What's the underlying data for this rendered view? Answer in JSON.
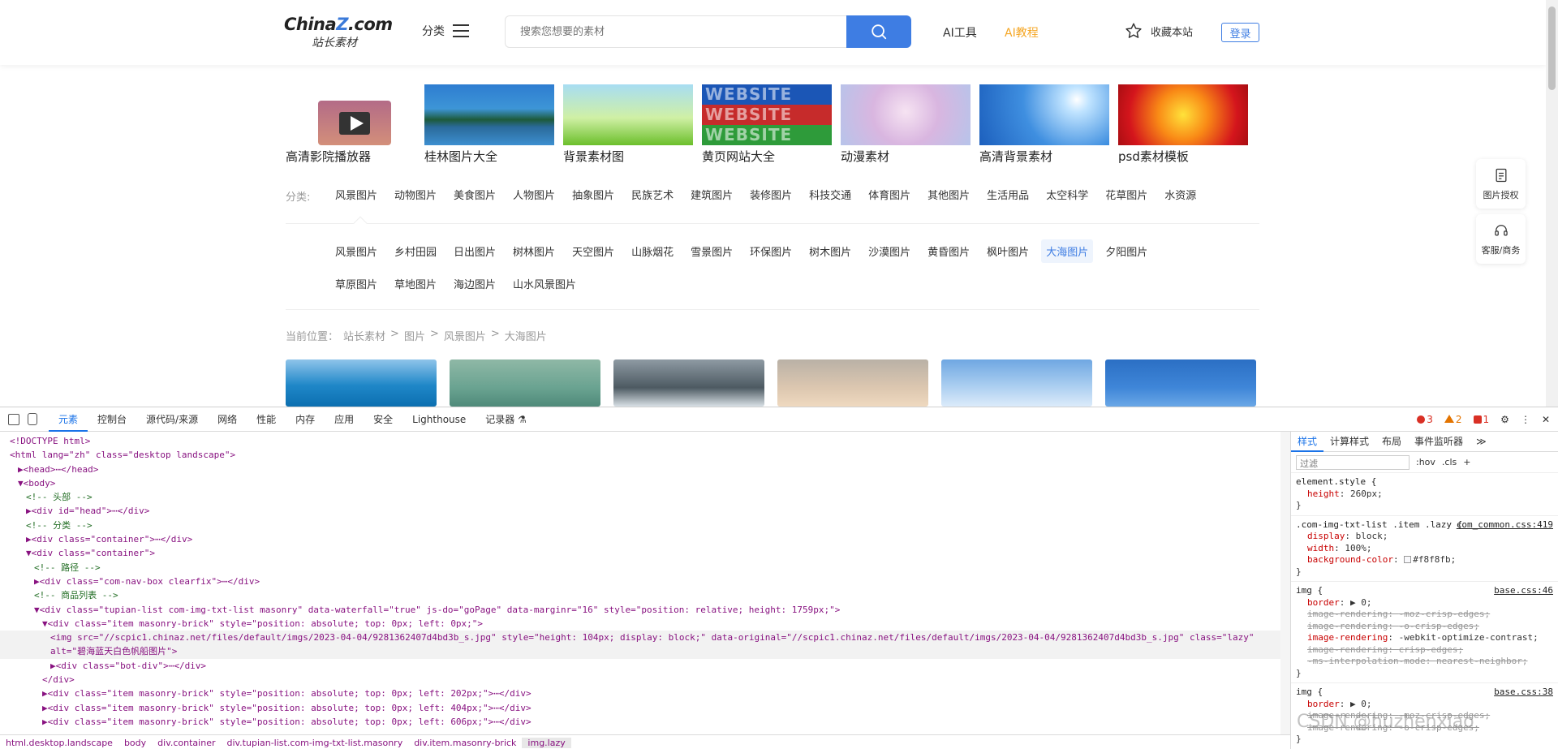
{
  "header": {
    "logo_main": "Chinaz.com",
    "logo_z": "Z",
    "logo_pre": "China",
    "logo_post": ".com",
    "logo_sub": "站长素材",
    "category_label": "分类",
    "search_placeholder": "搜索您想要的素材",
    "nav_ai_tools": "AI工具",
    "nav_ai_course": "AI教程",
    "favorite_label": "收藏本站",
    "login_label": "登录",
    "accent_color": "#3e7de3"
  },
  "featured": [
    {
      "caption": "高清影院播放器"
    },
    {
      "caption": "桂林图片大全"
    },
    {
      "caption": "背景素材图"
    },
    {
      "caption": "黄页网站大全",
      "overlay": [
        "WEBSITE",
        "WEBSITE",
        "WEBSITE"
      ]
    },
    {
      "caption": "动漫素材"
    },
    {
      "caption": "高清背景素材"
    },
    {
      "caption": "psd素材模板"
    }
  ],
  "categories": {
    "label": "分类:",
    "items": [
      "风景图片",
      "动物图片",
      "美食图片",
      "人物图片",
      "抽象图片",
      "民族艺术",
      "建筑图片",
      "装修图片",
      "科技交通",
      "体育图片",
      "其他图片",
      "生活用品",
      "太空科学",
      "花草图片",
      "水资源"
    ],
    "active": "风景图片"
  },
  "sub_categories": {
    "row1": [
      "风景图片",
      "乡村田园",
      "日出图片",
      "树林图片",
      "天空图片",
      "山脉烟花",
      "雪景图片",
      "环保图片",
      "树木图片",
      "沙漠图片",
      "黄昏图片",
      "枫叶图片",
      "大海图片",
      "夕阳图片"
    ],
    "row2": [
      "草原图片",
      "草地图片",
      "海边图片",
      "山水风景图片"
    ],
    "active": "大海图片"
  },
  "breadcrumb": {
    "prefix": "当前位置：",
    "items": [
      "站长素材",
      "图片",
      "风景图片",
      "大海图片"
    ],
    "separator": ">"
  },
  "side_buttons": [
    {
      "label": "图片授权"
    },
    {
      "label": "客服/商务"
    }
  ],
  "devtools": {
    "tabs": [
      "元素",
      "控制台",
      "源代码/来源",
      "网络",
      "性能",
      "内存",
      "应用",
      "安全",
      "Lighthouse",
      "记录器 ⚗"
    ],
    "active_tab": "元素",
    "error_count": "3",
    "warning_count": "2",
    "issue_count": "1",
    "style_tabs": [
      "样式",
      "计算样式",
      "布局",
      "事件监听器",
      "≫"
    ],
    "filter_placeholder": "过滤",
    "filter_hov": ":hov",
    "filter_cls": ".cls",
    "dom_lines": [
      "<!DOCTYPE html>",
      "<html lang=\"zh\" class=\"desktop landscape\">",
      "▶<head>⋯</head>",
      "▼<body>",
      "<!-- 头部 -->",
      "▶<div id=\"head\">⋯</div>",
      "<!-- 分类 -->",
      "▶<div class=\"container\">⋯</div>",
      "▼<div class=\"container\">",
      "<!-- 路径 -->",
      "▶<div class=\"com-nav-box clearfix\">⋯</div>",
      "<!-- 商品列表 -->",
      "▼<div class=\"tupian-list com-img-txt-list masonry\" data-waterfall=\"true\" js-do=\"goPage\" data-marginr=\"16\" style=\"position: relative; height: 1759px;\">",
      "▼<div class=\"item masonry-brick\" style=\"position: absolute; top: 0px; left: 0px;\">",
      "<img src=\"//scpic1.chinaz.net/files/default/imgs/2023-04-04/9281362407d4bd3b_s.jpg\" style=\"height: 104px; display: block;\" data-original=\"//scpic1.chinaz.net/files/default/imgs/2023-04-04/9281362407d4bd3b_s.jpg\" class=\"lazy\"",
      "alt=\"碧海蓝天白色帆船图片\">",
      "▶<div class=\"bot-div\">⋯</div>",
      "</div>",
      "▶<div class=\"item masonry-brick\" style=\"position: absolute; top: 0px; left: 202px;\">⋯</div>",
      "▶<div class=\"item masonry-brick\" style=\"position: absolute; top: 0px; left: 404px;\">⋯</div>",
      "▶<div class=\"item masonry-brick\" style=\"position: absolute; top: 0px; left: 606px;\">⋯</div>"
    ],
    "status_path": [
      "html.desktop.landscape",
      "body",
      "div.container",
      "div.tupian-list.com-img-txt-list.masonry",
      "div.item.masonry-brick",
      "img.lazy"
    ],
    "styles": [
      {
        "selector": "element.style {",
        "source": "",
        "props": [
          [
            "height",
            "260px;"
          ]
        ]
      },
      {
        "selector": ".com-img-txt-list .item .lazy {",
        "source": "com_common.css:419",
        "props": [
          [
            "display",
            "block;"
          ],
          [
            "width",
            "100%;"
          ],
          [
            "background-color",
            "#f8f8fb;"
          ]
        ]
      },
      {
        "selector": "img {",
        "source": "base.css:46",
        "props": [
          [
            "border",
            "▶ 0;"
          ],
          [
            "image-rendering",
            "-moz-crisp-edges;"
          ],
          [
            "image-rendering",
            "-o-crisp-edges;"
          ],
          [
            "image-rendering",
            "-webkit-optimize-contrast;"
          ],
          [
            "image-rendering",
            "crisp-edges;"
          ],
          [
            "-ms-interpolation-mode",
            "nearest-neighbor;"
          ]
        ]
      },
      {
        "selector": "img {",
        "source": "base.css:38",
        "props": [
          [
            "border",
            "▶ 0;"
          ],
          [
            "image-rendering",
            "-moz-crisp-edges;"
          ],
          [
            "image-rendering",
            "-o-crisp-edges;"
          ]
        ]
      }
    ],
    "watermark": "CSDN @huzhenxiao"
  }
}
